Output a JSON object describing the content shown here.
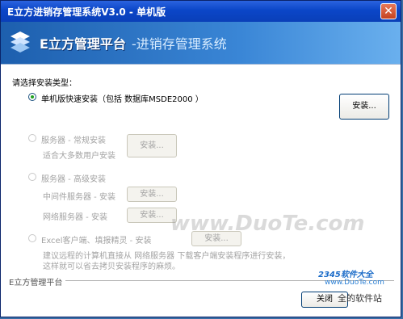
{
  "window": {
    "title": "E立方进销存管理系统V3.0 - 单机版",
    "close": "✕"
  },
  "banner": {
    "brand": "E立方管理平台",
    "subtitle": "-进销存管理系统"
  },
  "prompt": "请选择安装类型：",
  "options": {
    "single": {
      "label": "单机版快速安装（包括 数据库MSDE2000 ）",
      "button": "安装..."
    },
    "server_normal": {
      "label": "服务器 - 常规安装",
      "desc": "适合大多数用户安装",
      "button": "安装..."
    },
    "server_advanced": {
      "label": "服务器 - 高级安装",
      "middle": {
        "label": "中间件服务器 - 安装",
        "button": "安装..."
      },
      "network": {
        "label": "网络服务器 - 安装",
        "button": "安装..."
      }
    },
    "excel": {
      "label": "Excel客户端、填报精灵 - 安装",
      "button": "安装...",
      "desc1": "建议远程的计算机直接从 网络服务器 下载客户端安装程序进行安装，",
      "desc2": "这样就可以省去拷贝安装程序的麻烦。"
    }
  },
  "footer": {
    "brand": "E立方管理平台",
    "close": "关闭"
  },
  "watermark": "www.DuoTe.com",
  "badge": {
    "brand": "2345软件大全",
    "site": "www.DuoTe.com",
    "tagline": "全的软件站"
  }
}
